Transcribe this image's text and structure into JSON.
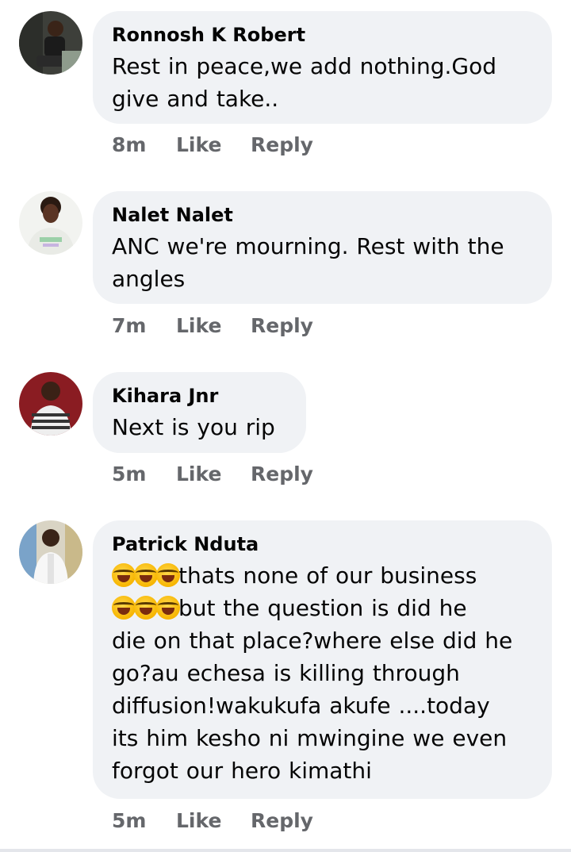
{
  "comments": [
    {
      "author": "Ronnosh K Robert",
      "lines": [
        "Rest in peace,we add nothing.God",
        "give and take.."
      ],
      "time": "8m",
      "like": "Like",
      "reply": "Reply",
      "avatar_icon": "user-avatar-photo"
    },
    {
      "author": "Nalet Nalet",
      "lines": [
        "ANC we're mourning. Rest with the",
        "angles"
      ],
      "time": "7m",
      "like": "Like",
      "reply": "Reply",
      "avatar_icon": "user-avatar-photo"
    },
    {
      "author": "Kihara Jnr",
      "lines": [
        "Next is you rip"
      ],
      "time": "5m",
      "like": "Like",
      "reply": "Reply",
      "avatar_icon": "user-avatar-photo"
    },
    {
      "author": "Patrick Nduta",
      "lines": [
        "thats none of our business",
        "but the question is did he",
        "die on that place?where else did he",
        "go?au echesa is killing through",
        "diffusion!wakukufa akufe ....today",
        "its him kesho ni mwingine we even",
        "forgot our hero kimathi"
      ],
      "emoji": "rolling-on-floor-laughing-emoji",
      "time": "5m",
      "like": "Like",
      "reply": "Reply",
      "avatar_icon": "user-avatar-photo"
    }
  ],
  "colors": {
    "bubble": "#f0f2f5",
    "text": "#050505",
    "meta": "#65676b"
  }
}
